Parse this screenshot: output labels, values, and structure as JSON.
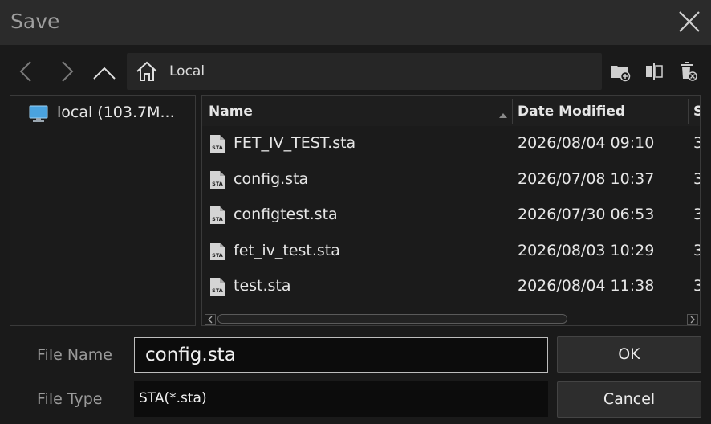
{
  "dialog": {
    "title": "Save"
  },
  "toolbar": {
    "path": "Local",
    "icons": [
      "back-icon",
      "forward-icon",
      "up-icon",
      "home-icon",
      "new-folder-icon",
      "rename-icon",
      "delete-icon"
    ]
  },
  "tree": {
    "items": [
      {
        "label": "local  (103.7M...",
        "icon": "computer-icon"
      }
    ]
  },
  "table": {
    "columns": [
      "Name",
      "Date Modified",
      "S"
    ],
    "rows": [
      {
        "name": "FET_IV_TEST.sta",
        "date": "2026/08/04 09:10",
        "size": "3"
      },
      {
        "name": "config.sta",
        "date": "2026/07/08 10:37",
        "size": "3"
      },
      {
        "name": "configtest.sta",
        "date": "2026/07/30 06:53",
        "size": "3"
      },
      {
        "name": "fet_iv_test.sta",
        "date": "2026/08/03 10:29",
        "size": "3"
      },
      {
        "name": "test.sta",
        "date": "2026/08/04 11:38",
        "size": "3"
      }
    ],
    "file_icon_text": "STA",
    "sort_column": "Name",
    "sort_direction": "ascending"
  },
  "form": {
    "file_name_label": "File Name",
    "file_name_value": "config.sta",
    "file_type_label": "File Type",
    "file_type_value": "STA(*.sta)"
  },
  "buttons": {
    "ok": "OK",
    "cancel": "Cancel"
  },
  "colors": {
    "background": "#1a1a1a",
    "titlebar": "#2b2b2b",
    "text": "#dcdcdc",
    "accent_icon": "#4aa3df"
  }
}
